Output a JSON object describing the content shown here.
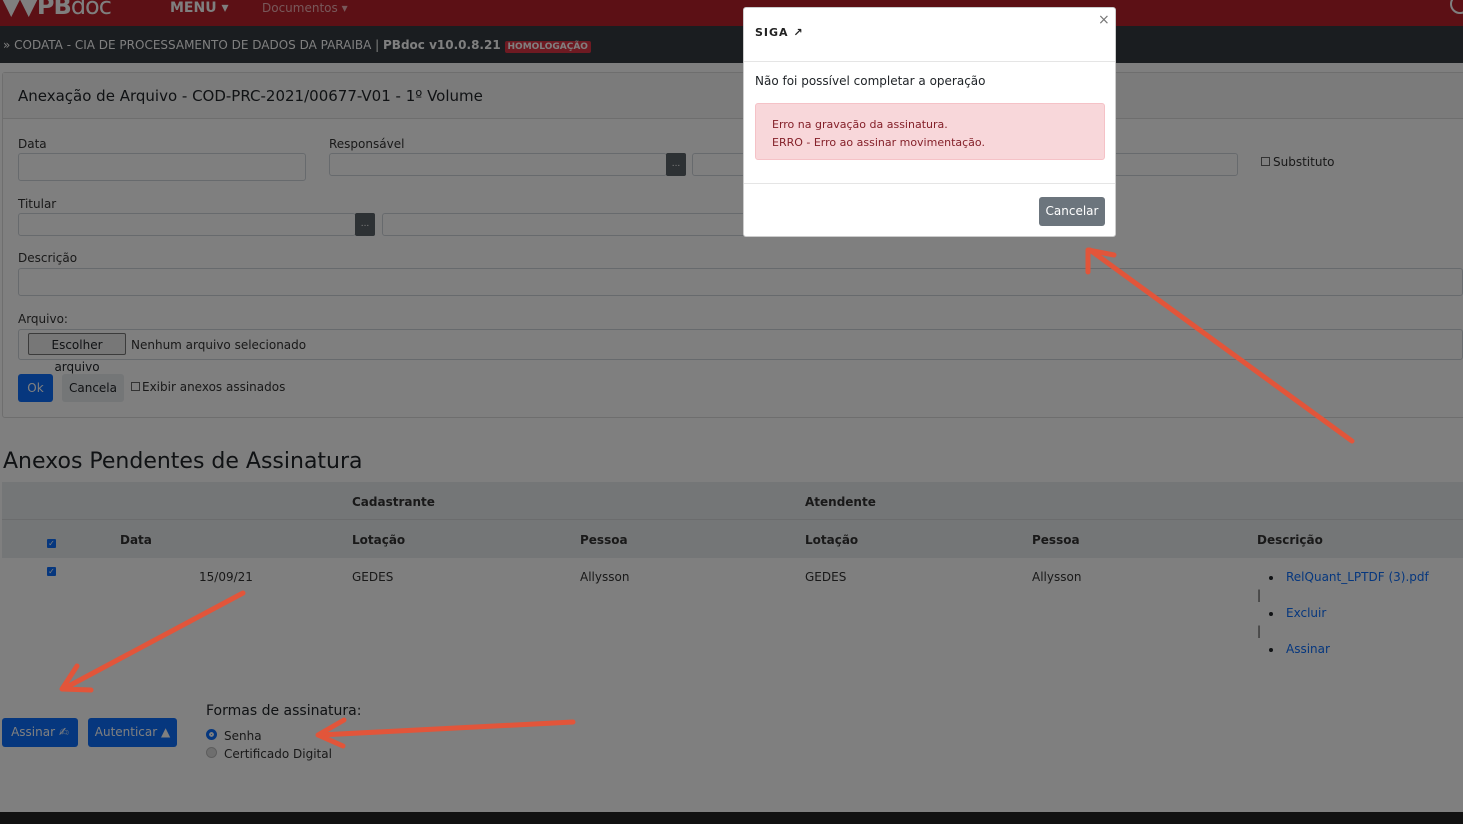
{
  "navbar": {
    "brand_main": "PB",
    "brand_suffix": "doc",
    "menu_label": "MENU ▾",
    "documents_label": "Documentos ▾"
  },
  "subbar": {
    "org_text": "» CODATA - CIA DE PROCESSAMENTO DE DADOS DA PARAIBA | ",
    "version": "PBdoc v10.0.8.21",
    "env_badge": "HOMOLOGAÇÃO"
  },
  "form": {
    "title": "Anexação de Arquivo - COD-PRC-2021/00677-V01 - 1º Volume",
    "data_label": "Data",
    "responsavel_label": "Responsável",
    "substituto_label": "Substituto",
    "titular_label": "Titular",
    "descricao_label": "Descrição",
    "arquivo_label": "Arquivo:",
    "choose_file_label": "Escolher arquivo",
    "no_file_text": "Nenhum arquivo selecionado",
    "dots": "...",
    "ok_label": "Ok",
    "cancel_label": "Cancela",
    "show_signed_label": "Exibir anexos assinados"
  },
  "pending": {
    "title": "Anexos Pendentes de Assinatura",
    "group_cadastrante": "Cadastrante",
    "group_atendente": "Atendente",
    "col_data": "Data",
    "col_lotacao": "Lotação",
    "col_pessoa": "Pessoa",
    "col_lotacao2": "Lotação",
    "col_pessoa2": "Pessoa",
    "col_descricao": "Descrição",
    "rows": [
      {
        "data": "15/09/21",
        "cad_lotacao": "GEDES",
        "cad_pessoa": "Allysson",
        "at_lotacao": "GEDES",
        "at_pessoa": "Allysson",
        "file_link": "RelQuant_LPTDF (3).pdf",
        "excluir": "Excluir",
        "assinar": "Assinar",
        "sep": "|"
      }
    ]
  },
  "signing": {
    "assinar_label": "Assinar ✍",
    "autenticar_label": "Autenticar ▲",
    "forms_title": "Formas de assinatura:",
    "option_senha": "Senha",
    "option_certificado": "Certificado Digital"
  },
  "modal": {
    "logo": "SIGA",
    "close": "×",
    "message": "Não foi possível completar a operação",
    "error_line1": "Erro na gravação da assinatura.",
    "error_line2": "ERRO - Erro ao assinar movimentação.",
    "cancel_label": "Cancelar"
  },
  "colors": {
    "navbar_red": "#b8202a",
    "primary_blue": "#0d6efd",
    "alert_bg": "#f8d7da",
    "annotation_arrow": "#e2553a"
  }
}
